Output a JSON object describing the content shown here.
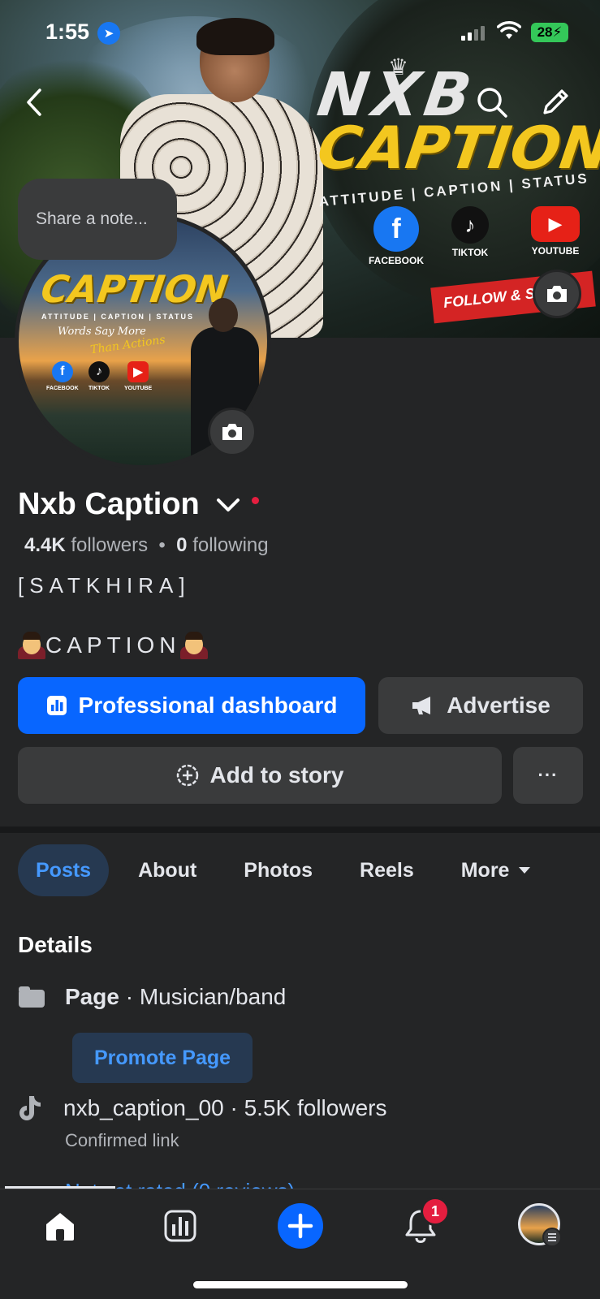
{
  "status_bar": {
    "time": "1:55",
    "battery": "28"
  },
  "cover": {
    "brand_line1": "NXB",
    "brand_line2": "CAPTION",
    "tagline": "ATTITUDE | CAPTION | STATUS",
    "social": [
      "FACEBOOK",
      "TIKTOK",
      "YOUTUBE"
    ],
    "banner": "FOLLOW & SUBS"
  },
  "note": {
    "placeholder": "Share a note..."
  },
  "avatar": {
    "brand": "CAPTION",
    "tagline": "ATTITUDE | CAPTION | STATUS",
    "words": "Words Say More",
    "than": "Than Actions",
    "social": [
      "FACEBOOK",
      "TIKTOK",
      "YOUTUBE"
    ]
  },
  "profile": {
    "name": "Nxb Caption",
    "followers_count": "4.4K",
    "followers_label": "followers",
    "following_count": "0",
    "following_label": "following",
    "bio_line1": "[SATKHIRA]",
    "bio_line2": "CAPTION"
  },
  "actions": {
    "dashboard": "Professional dashboard",
    "advertise": "Advertise",
    "add_story": "Add to story",
    "more": "···"
  },
  "tabs": [
    {
      "label": "Posts"
    },
    {
      "label": "About"
    },
    {
      "label": "Photos"
    },
    {
      "label": "Reels"
    },
    {
      "label": "More"
    }
  ],
  "details": {
    "title": "Details",
    "page_label": "Page",
    "page_category": " · Musician/band",
    "promote": "Promote Page",
    "tiktok": "nxb_caption_00 · 5.5K followers",
    "tiktok_sub": "Confirmed link",
    "rating": "Not yet rated (0 reviews)"
  },
  "nav": {
    "notification_count": "1"
  },
  "colors": {
    "accent": "#0866ff",
    "link": "#4599ff",
    "background": "#242526",
    "badge": "#e41e3f"
  }
}
